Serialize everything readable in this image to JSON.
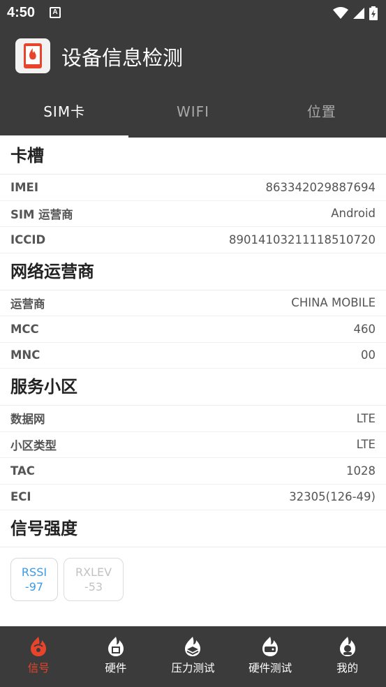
{
  "status_bar": {
    "time": "4:50",
    "notification_glyph": "A"
  },
  "app_bar": {
    "title": "设备信息检测",
    "logo_icon": "flame-phone-icon"
  },
  "tabs": [
    {
      "label": "SIM卡",
      "active": true
    },
    {
      "label": "WIFI",
      "active": false
    },
    {
      "label": "位置",
      "active": false
    }
  ],
  "sections": {
    "slot": {
      "title": "卡槽",
      "rows": [
        {
          "label": "IMEI",
          "value": "863342029887694"
        },
        {
          "label": "SIM 运营商",
          "value": "Android"
        },
        {
          "label": "ICCID",
          "value": "89014103211118510720"
        }
      ]
    },
    "operator": {
      "title": "网络运营商",
      "rows": [
        {
          "label": "运营商",
          "value": "CHINA MOBILE"
        },
        {
          "label": "MCC",
          "value": "460"
        },
        {
          "label": "MNC",
          "value": "00"
        }
      ]
    },
    "cell": {
      "title": "服务小区",
      "rows": [
        {
          "label": "数据网",
          "value": "LTE"
        },
        {
          "label": "小区类型",
          "value": "LTE"
        },
        {
          "label": "TAC",
          "value": "1028"
        },
        {
          "label": "ECI",
          "value": "32305(126-49)"
        }
      ]
    },
    "signal": {
      "title": "信号强度",
      "tags": [
        {
          "name": "RSSI",
          "value": "-97",
          "active": true
        },
        {
          "name": "RXLEV",
          "value": "-53",
          "active": false
        }
      ]
    }
  },
  "bottom_nav": [
    {
      "label": "信号",
      "icon": "signal-flame-icon",
      "active": true
    },
    {
      "label": "硬件",
      "icon": "chip-flame-icon",
      "active": false
    },
    {
      "label": "压力测试",
      "icon": "layers-flame-icon",
      "active": false
    },
    {
      "label": "硬件测试",
      "icon": "device-flame-icon",
      "active": false
    },
    {
      "label": "我的",
      "icon": "user-flame-icon",
      "active": false
    }
  ],
  "colors": {
    "bar_bg": "#3b3b3b",
    "accent_red": "#e8442c",
    "accent_blue": "#3a9be8"
  }
}
